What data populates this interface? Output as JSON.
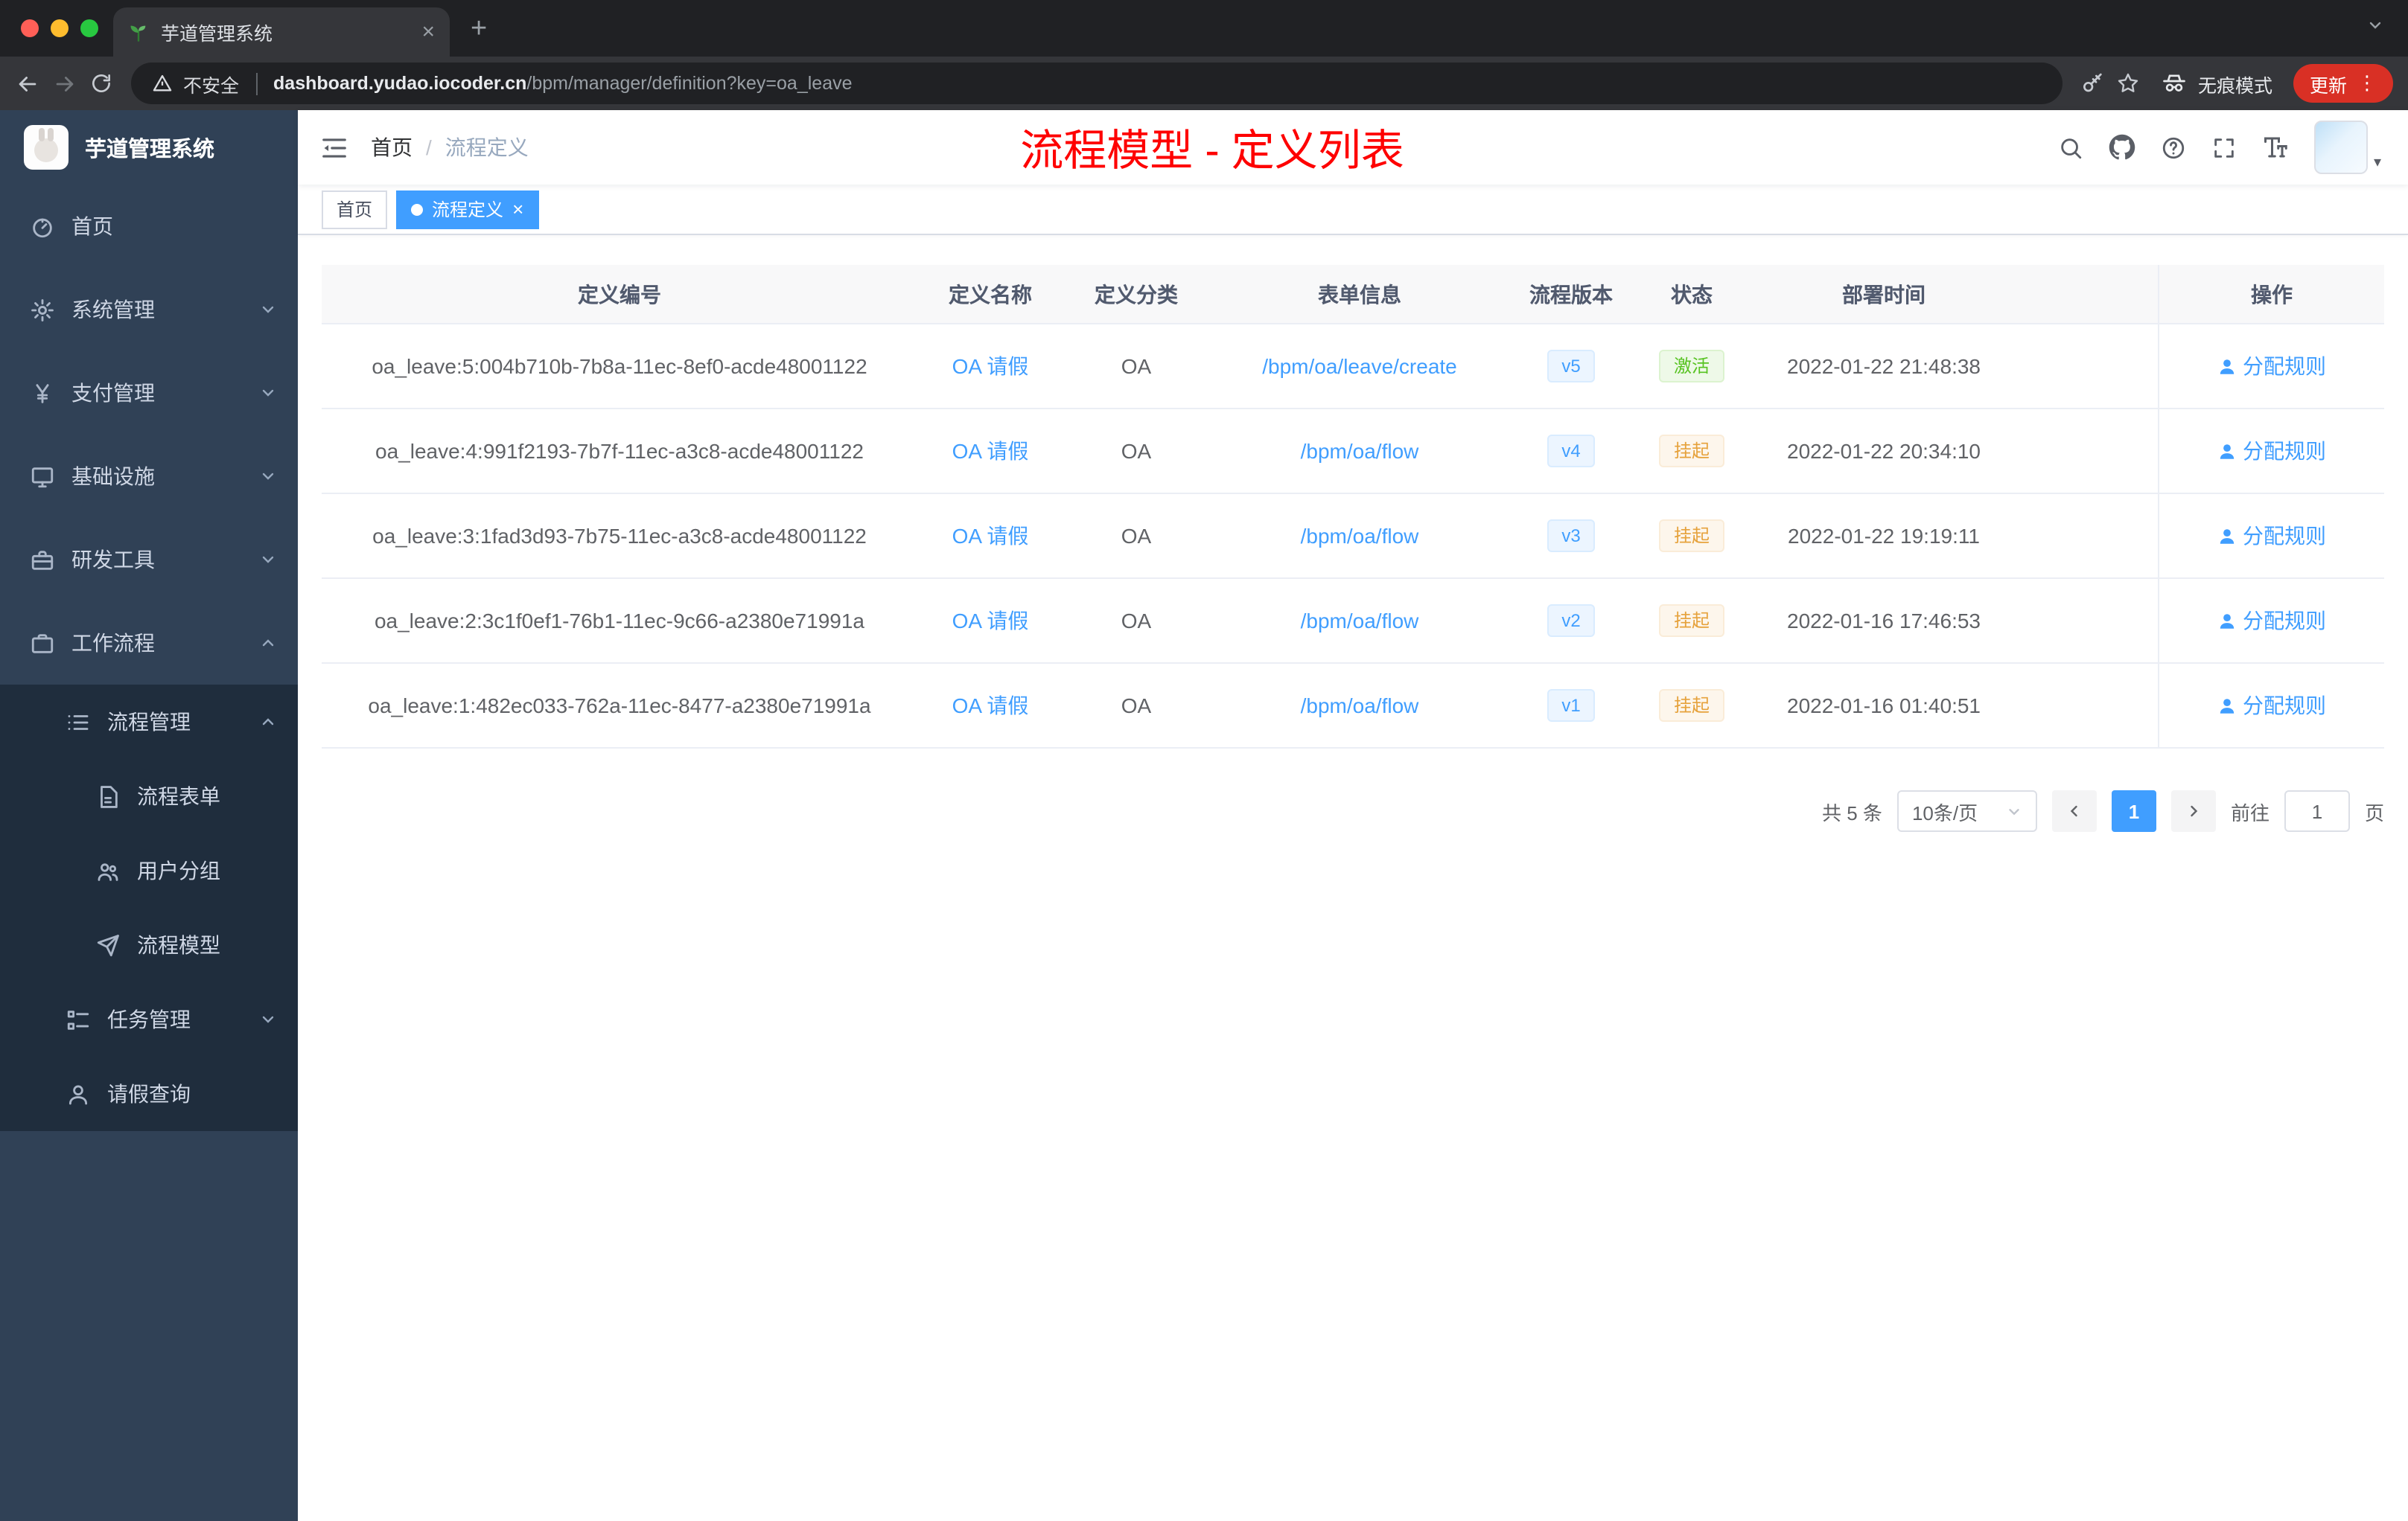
{
  "colors": {
    "accent": "#409eff",
    "success": "#58c322",
    "warning": "#e6a23c",
    "annotation_red": "#fe0000",
    "sidebar_bg": "#304156",
    "sidebar_submenu_bg": "#1f2d3d",
    "browser_dark": "#202124",
    "toolbar_dark": "#35363a",
    "update_pill": "#d93025"
  },
  "browser": {
    "tab_title": "芋道管理系统",
    "security_label": "不安全",
    "url_domain": "dashboard.yudao.iocoder.cn",
    "url_path": "/bpm/manager/definition?key=oa_leave",
    "incognito_label": "无痕模式",
    "update_label": "更新"
  },
  "sidebar": {
    "app_title": "芋道管理系统",
    "items": [
      {
        "label": "首页",
        "icon": "dashboard-icon",
        "level": 1,
        "expandable": false,
        "expanded": false,
        "dark": false
      },
      {
        "label": "系统管理",
        "icon": "gear-icon",
        "level": 1,
        "expandable": true,
        "expanded": false,
        "dark": false
      },
      {
        "label": "支付管理",
        "icon": "yen-icon",
        "level": 1,
        "expandable": true,
        "expanded": false,
        "dark": false
      },
      {
        "label": "基础设施",
        "icon": "monitor-icon",
        "level": 1,
        "expandable": true,
        "expanded": false,
        "dark": false
      },
      {
        "label": "研发工具",
        "icon": "toolbox-icon",
        "level": 1,
        "expandable": true,
        "expanded": false,
        "dark": false
      },
      {
        "label": "工作流程",
        "icon": "briefcase-icon",
        "level": 1,
        "expandable": true,
        "expanded": true,
        "dark": false
      },
      {
        "label": "流程管理",
        "icon": "list-icon",
        "level": 2,
        "expandable": true,
        "expanded": true,
        "dark": true
      },
      {
        "label": "流程表单",
        "icon": "form-icon",
        "level": 3,
        "expandable": false,
        "expanded": false,
        "dark": true
      },
      {
        "label": "用户分组",
        "icon": "users-icon",
        "level": 3,
        "expandable": false,
        "expanded": false,
        "dark": true
      },
      {
        "label": "流程模型",
        "icon": "send-icon",
        "level": 3,
        "expandable": false,
        "expanded": false,
        "dark": true
      },
      {
        "label": "任务管理",
        "icon": "tasks-icon",
        "level": 2,
        "expandable": true,
        "expanded": false,
        "dark": true
      },
      {
        "label": "请假查询",
        "icon": "user-icon",
        "level": 2,
        "expandable": false,
        "expanded": false,
        "dark": true
      }
    ]
  },
  "header": {
    "breadcrumb": [
      "首页",
      "流程定义"
    ],
    "breadcrumb_separator": "/",
    "annotation": "流程模型 - 定义列表"
  },
  "tags": [
    {
      "label": "首页",
      "active": false,
      "closable": false
    },
    {
      "label": "流程定义",
      "active": true,
      "closable": true
    }
  ],
  "table": {
    "columns": [
      "定义编号",
      "定义名称",
      "定义分类",
      "表单信息",
      "流程版本",
      "状态",
      "部署时间",
      "操作"
    ],
    "rows": [
      {
        "id": "oa_leave:5:004b710b-7b8a-11ec-8ef0-acde48001122",
        "name": "OA 请假",
        "category": "OA",
        "form": "/bpm/oa/leave/create",
        "version": "v5",
        "status": "激活",
        "status_type": "success",
        "time": "2022-01-22 21:48:38",
        "action": "分配规则"
      },
      {
        "id": "oa_leave:4:991f2193-7b7f-11ec-a3c8-acde48001122",
        "name": "OA 请假",
        "category": "OA",
        "form": "/bpm/oa/flow",
        "version": "v4",
        "status": "挂起",
        "status_type": "warning",
        "time": "2022-01-22 20:34:10",
        "action": "分配规则"
      },
      {
        "id": "oa_leave:3:1fad3d93-7b75-11ec-a3c8-acde48001122",
        "name": "OA 请假",
        "category": "OA",
        "form": "/bpm/oa/flow",
        "version": "v3",
        "status": "挂起",
        "status_type": "warning",
        "time": "2022-01-22 19:19:11",
        "action": "分配规则"
      },
      {
        "id": "oa_leave:2:3c1f0ef1-76b1-11ec-9c66-a2380e71991a",
        "name": "OA 请假",
        "category": "OA",
        "form": "/bpm/oa/flow",
        "version": "v2",
        "status": "挂起",
        "status_type": "warning",
        "time": "2022-01-16 17:46:53",
        "action": "分配规则"
      },
      {
        "id": "oa_leave:1:482ec033-762a-11ec-8477-a2380e71991a",
        "name": "OA 请假",
        "category": "OA",
        "form": "/bpm/oa/flow",
        "version": "v1",
        "status": "挂起",
        "status_type": "warning",
        "time": "2022-01-16 01:40:51",
        "action": "分配规则"
      }
    ]
  },
  "pagination": {
    "total": "共 5 条",
    "page_size": "10条/页",
    "current": "1",
    "goto_label": "前往",
    "goto_value": "1",
    "unit_label": "页"
  }
}
